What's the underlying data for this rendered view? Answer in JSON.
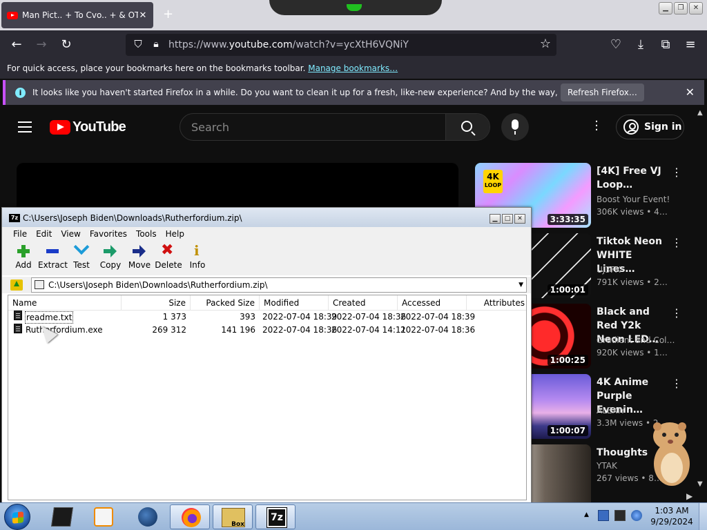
{
  "browser": {
    "tab_title": "Man Pict.. + To Cvo.. + & OTHER",
    "tab_close": "✕",
    "new_tab": "+",
    "url_prefix": "https://www.",
    "url_host": "youtube.com",
    "url_path": "/watch?v=ycXtH6VQNiY",
    "bookmarks_text": "For quick access, place your bookmarks here on the bookmarks toolbar.",
    "bookmarks_link": "Manage bookmarks…",
    "notification_text": "It looks like you haven't started Firefox in a while. Do you want to clean it up for a fresh, like-new experience? And by the way, welcome back!",
    "refresh_button": "Refresh Firefox…",
    "notification_close": "✕"
  },
  "youtube": {
    "logo_text": "YouTube",
    "search_placeholder": "Search",
    "signin_label": "Sign in",
    "recommendations": [
      {
        "title": "[4K] Free VJ Loop…",
        "channel": "Boost Your Event!",
        "meta": "306K views • 4…",
        "duration": "3:33:35",
        "badge_main": "4K",
        "badge_sub": "LOOP"
      },
      {
        "title": "Tiktok Neon WHITE Lines…",
        "channel": "UJ3FX",
        "meta": "791K views • 2…",
        "duration": "1:00:01"
      },
      {
        "title": "Black and Red Y2k Neon LED…",
        "channel": "Gradient and Col…",
        "meta": "920K views • 1…",
        "duration": "1:00:25"
      },
      {
        "title": "4K Anime Purple Evenin…",
        "channel": "ALEXIY",
        "meta": "3.3M views • 2…",
        "duration": "1:00:07"
      },
      {
        "title": "Thoughts",
        "channel": "YTAK",
        "meta": "267 views • 8…",
        "duration": ""
      }
    ]
  },
  "sevenzip": {
    "title": "C:\\Users\\Joseph Biden\\Downloads\\Rutherfordium.zip\\",
    "menu": [
      "File",
      "Edit",
      "View",
      "Favorites",
      "Tools",
      "Help"
    ],
    "toolbar": [
      {
        "label": "Add",
        "icon": "add-icon"
      },
      {
        "label": "Extract",
        "icon": "extract-icon"
      },
      {
        "label": "Test",
        "icon": "test-icon"
      },
      {
        "label": "Copy",
        "icon": "copy-icon"
      },
      {
        "label": "Move",
        "icon": "move-icon"
      },
      {
        "label": "Delete",
        "icon": "delete-icon"
      },
      {
        "label": "Info",
        "icon": "info-icon"
      }
    ],
    "path": "C:\\Users\\Joseph Biden\\Downloads\\Rutherfordium.zip\\",
    "columns": [
      "Name",
      "Size",
      "Packed Size",
      "Modified",
      "Created",
      "Accessed",
      "Attributes"
    ],
    "files": [
      {
        "name": "readme.txt",
        "size": "1 373",
        "packed": "393",
        "modified": "2022-07-04 18:39",
        "created": "2022-07-04 18:36",
        "accessed": "2022-07-04 18:39"
      },
      {
        "name": "Rutherfordium.exe",
        "size": "269 312",
        "packed": "141 196",
        "modified": "2022-07-04 18:36",
        "created": "2022-07-04 14:11",
        "accessed": "2022-07-04 18:36"
      }
    ]
  },
  "taskbar": {
    "time": "1:03 AM",
    "date": "9/29/2024",
    "box_label": "Box",
    "z7_label": "7z"
  }
}
